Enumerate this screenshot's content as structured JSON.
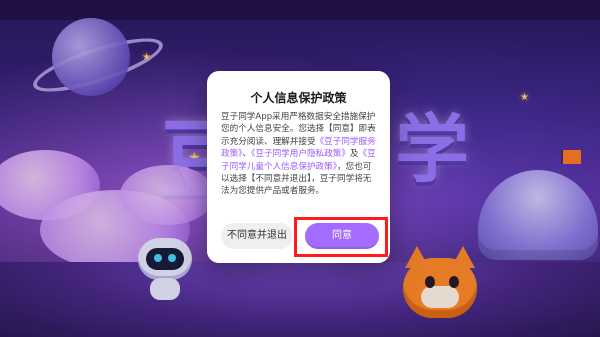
{
  "background": {
    "logo_chars": [
      "豆",
      "学"
    ]
  },
  "dialog": {
    "title": "个人信息保护政策",
    "text": {
      "part1": "豆子同学App采用严格数据安全措施保护您的个人信息安全。您选择【同意】即表示充分阅读、理解并接受",
      "link1": "《豆子同学服务政策》",
      "sep1": "、",
      "link2": "《豆子同学用户隐私政策》",
      "sep2": "及",
      "link3": "《豆子同学儿童个人信息保护政策》",
      "part2": "，您也可以选择【不同意并退出】，豆子同学将无法为您提供产品或者服务。"
    },
    "buttons": {
      "decline": "不同意并退出",
      "agree": "同意"
    }
  },
  "colors": {
    "accent": "#a46bff",
    "link": "#9b5bff",
    "highlight": "#ff1b1b"
  }
}
